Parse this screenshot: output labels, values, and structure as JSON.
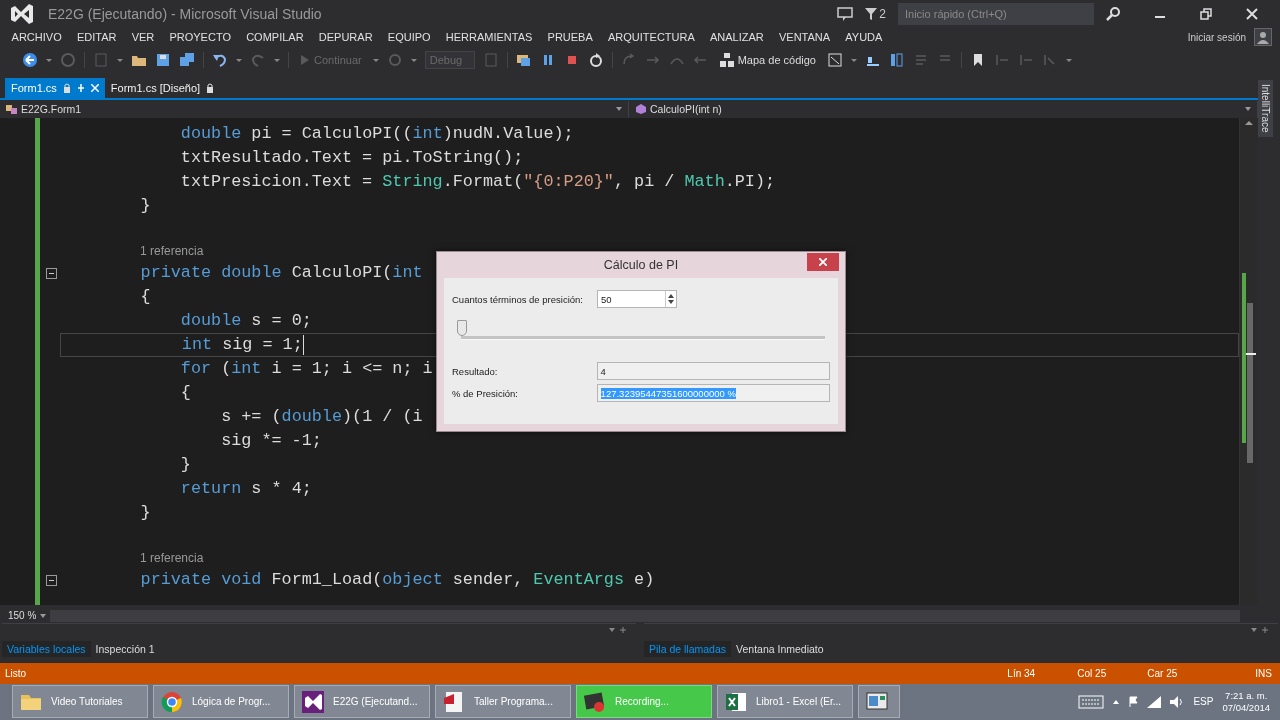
{
  "window": {
    "title": "E22G (Ejecutando) - Microsoft Visual Studio",
    "notifications": "2",
    "quick_launch": {
      "placeholder": "Inicio rápido (Ctrl+Q)"
    },
    "sign_in": "Iniciar sesión"
  },
  "menu": [
    "ARCHIVO",
    "EDITAR",
    "VER",
    "PROYECTO",
    "COMPILAR",
    "DEPURAR",
    "EQUIPO",
    "HERRAMIENTAS",
    "PRUEBA",
    "ARQUITECTURA",
    "ANALIZAR",
    "VENTANA",
    "AYUDA"
  ],
  "toolbar": {
    "continue": {
      "label": "Continuar",
      "disabled": true
    },
    "configuration": {
      "value": "Debug",
      "disabled": true
    },
    "code_map": "Mapa de código"
  },
  "tabs": [
    {
      "label": "Form1.cs",
      "selected": true
    },
    {
      "label": "Form1.cs [Diseño]",
      "selected": false
    }
  ],
  "navigation": {
    "type": "E22G.Form1",
    "member": "CalculoPI(int n)"
  },
  "side_tab": "IntelliTrace",
  "code": [
    {
      "kind": "code",
      "current": false,
      "tokens": [
        {
          "kind": "keyword",
          "text": "            double"
        },
        {
          "kind": "plain",
          "text": " pi = CalculoPI(("
        },
        {
          "kind": "keyword",
          "text": "int"
        },
        {
          "kind": "plain",
          "text": ")nudN.Value);"
        }
      ]
    },
    {
      "kind": "code",
      "current": false,
      "tokens": [
        {
          "kind": "plain",
          "text": "            txtResultado.Text = pi.ToString();"
        }
      ]
    },
    {
      "kind": "code",
      "current": false,
      "tokens": [
        {
          "kind": "plain",
          "text": "            txtPresicion.Text = "
        },
        {
          "kind": "type",
          "text": "String"
        },
        {
          "kind": "plain",
          "text": ".Format("
        },
        {
          "kind": "string",
          "text": "\"{0:P20}\""
        },
        {
          "kind": "plain",
          "text": ", pi / "
        },
        {
          "kind": "type",
          "text": "Math"
        },
        {
          "kind": "plain",
          "text": ".PI);"
        }
      ]
    },
    {
      "kind": "code",
      "current": false,
      "tokens": [
        {
          "kind": "plain",
          "text": "        }"
        }
      ]
    },
    {
      "kind": "blank"
    },
    {
      "kind": "codelens",
      "text": "1 referencia"
    },
    {
      "kind": "fold_start",
      "current": false,
      "tokens": [
        {
          "kind": "keyword",
          "text": "        private double"
        },
        {
          "kind": "plain",
          "text": " CalculoPI("
        },
        {
          "kind": "keyword",
          "text": "int"
        }
      ]
    },
    {
      "kind": "code",
      "current": false,
      "tokens": [
        {
          "kind": "plain",
          "text": "        {"
        }
      ]
    },
    {
      "kind": "code",
      "current": false,
      "tokens": [
        {
          "kind": "keyword",
          "text": "            double"
        },
        {
          "kind": "plain",
          "text": " s = 0;"
        }
      ]
    },
    {
      "kind": "code",
      "current": true,
      "tokens": [
        {
          "kind": "keyword",
          "text": "            int"
        },
        {
          "kind": "plain",
          "text": " sig = 1;"
        }
      ]
    },
    {
      "kind": "code",
      "current": false,
      "tokens": [
        {
          "kind": "keyword",
          "text": "            for"
        },
        {
          "kind": "plain",
          "text": " ("
        },
        {
          "kind": "keyword",
          "text": "int"
        },
        {
          "kind": "plain",
          "text": " i = 1; i <= n; i"
        }
      ]
    },
    {
      "kind": "code",
      "current": false,
      "tokens": [
        {
          "kind": "plain",
          "text": "            {"
        }
      ]
    },
    {
      "kind": "code",
      "current": false,
      "tokens": [
        {
          "kind": "plain",
          "text": "                s += ("
        },
        {
          "kind": "keyword",
          "text": "double"
        },
        {
          "kind": "plain",
          "text": ")(1 / (i"
        }
      ]
    },
    {
      "kind": "code",
      "current": false,
      "tokens": [
        {
          "kind": "plain",
          "text": "                sig *= -1;"
        }
      ]
    },
    {
      "kind": "code",
      "current": false,
      "tokens": [
        {
          "kind": "plain",
          "text": "            }"
        }
      ]
    },
    {
      "kind": "code",
      "current": false,
      "tokens": [
        {
          "kind": "keyword",
          "text": "            return"
        },
        {
          "kind": "plain",
          "text": " s * 4;"
        }
      ]
    },
    {
      "kind": "code",
      "current": false,
      "tokens": [
        {
          "kind": "plain",
          "text": "        }"
        }
      ]
    },
    {
      "kind": "blank"
    },
    {
      "kind": "codelens",
      "text": "1 referencia"
    },
    {
      "kind": "fold_start",
      "current": false,
      "tokens": [
        {
          "kind": "keyword",
          "text": "        private void"
        },
        {
          "kind": "plain",
          "text": " Form1_Load("
        },
        {
          "kind": "keyword",
          "text": "object"
        },
        {
          "kind": "plain",
          "text": " sender, "
        },
        {
          "kind": "type",
          "text": "EventArgs"
        },
        {
          "kind": "plain",
          "text": " e)"
        }
      ]
    }
  ],
  "zoom": "150 %",
  "panels": [
    {
      "tabs": [
        {
          "label": "Variables locales",
          "selected": true
        },
        {
          "label": "Inspección 1",
          "selected": false
        }
      ]
    },
    {
      "tabs": [
        {
          "label": "Pila de llamadas",
          "selected": true
        },
        {
          "label": "Ventana Inmediato",
          "selected": false
        }
      ]
    }
  ],
  "status_bar": {
    "message": "Listo",
    "line": "Lín 34",
    "column": "Col 25",
    "char": "Car 25",
    "mode": "INS"
  },
  "dialog": {
    "title": "Cálculo de PI",
    "terms": {
      "label": "Cuantos términos de presición:",
      "value": "50"
    },
    "slider": {
      "level": 0.0
    },
    "result": {
      "label": "Resultado:",
      "value": "4"
    },
    "precision": {
      "label": "% de Presición:",
      "value": "127.32395447351600000000 %",
      "selected": true
    }
  },
  "taskbar": {
    "items": [
      {
        "kind": "folder",
        "label": "Video Tutoriales",
        "selected": false
      },
      {
        "kind": "browser",
        "label": "Lógica de Progr...",
        "selected": false
      },
      {
        "kind": "studio",
        "label": "E22G (Ejecutand...",
        "selected": false
      },
      {
        "kind": "pdf",
        "label": "Taller Programa...",
        "selected": false
      },
      {
        "kind": "recorder",
        "label": "Recording...",
        "selected": true
      },
      {
        "kind": "spreadsheet",
        "label": "Libro1 - Excel (Er...",
        "selected": false
      },
      {
        "kind": "window"
      }
    ],
    "language": "ESP",
    "time": "7:21 a. m.",
    "date": "07/04/2014"
  }
}
